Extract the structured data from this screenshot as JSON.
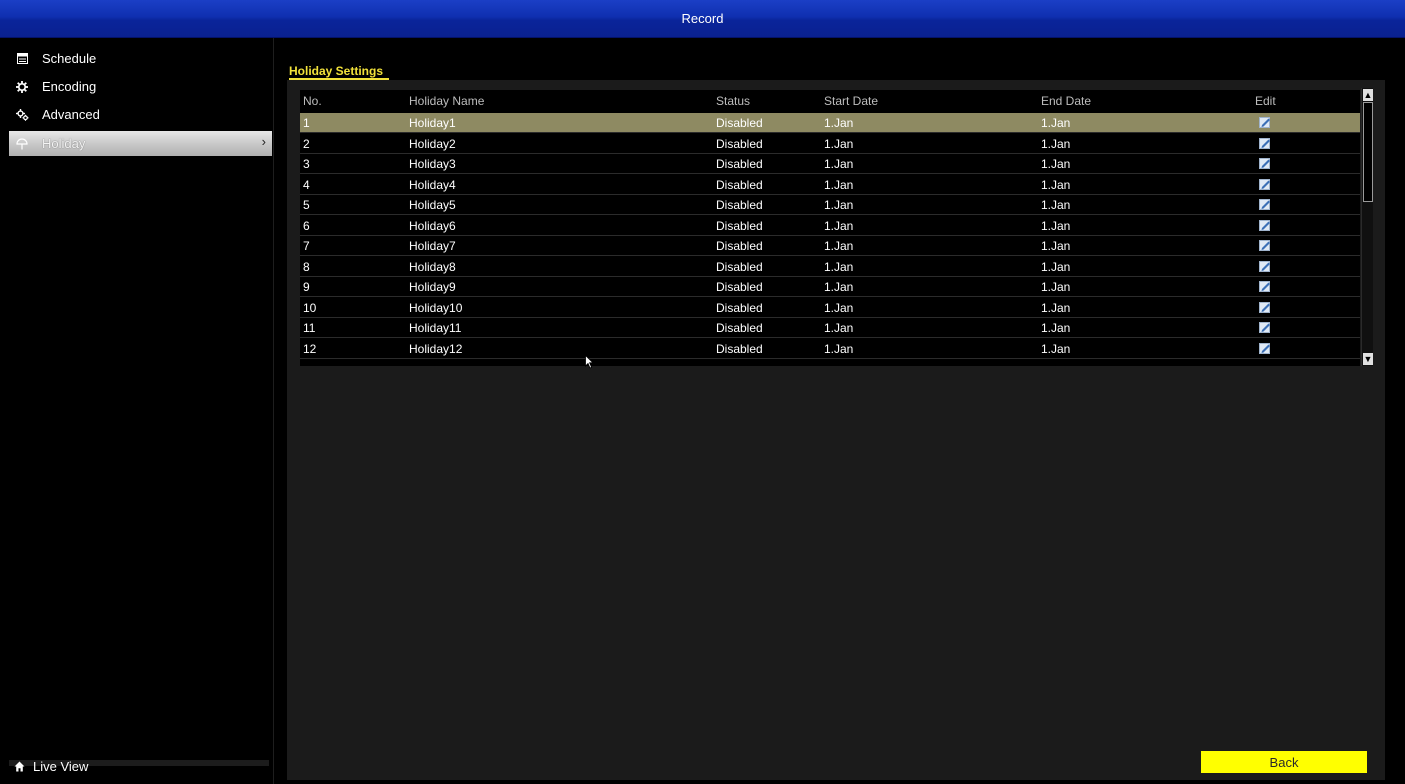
{
  "window": {
    "title": "Record"
  },
  "sidebar": {
    "items": [
      {
        "label": "Schedule",
        "icon": "schedule-icon"
      },
      {
        "label": "Encoding",
        "icon": "gear-icon"
      },
      {
        "label": "Advanced",
        "icon": "advanced-gear-icon"
      },
      {
        "label": "Holiday",
        "icon": "holiday-icon",
        "active": true
      }
    ],
    "live_view": {
      "label": "Live View",
      "icon": "home-icon"
    }
  },
  "main": {
    "section_title": "Holiday Settings",
    "table": {
      "headers": [
        "No.",
        "Holiday Name",
        "Status",
        "Start Date",
        "End Date",
        "Edit"
      ],
      "rows": [
        {
          "no": "1",
          "name": "Holiday1",
          "status": "Disabled",
          "start": "1.Jan",
          "end": "1.Jan",
          "selected": true
        },
        {
          "no": "2",
          "name": "Holiday2",
          "status": "Disabled",
          "start": "1.Jan",
          "end": "1.Jan"
        },
        {
          "no": "3",
          "name": "Holiday3",
          "status": "Disabled",
          "start": "1.Jan",
          "end": "1.Jan"
        },
        {
          "no": "4",
          "name": "Holiday4",
          "status": "Disabled",
          "start": "1.Jan",
          "end": "1.Jan"
        },
        {
          "no": "5",
          "name": "Holiday5",
          "status": "Disabled",
          "start": "1.Jan",
          "end": "1.Jan"
        },
        {
          "no": "6",
          "name": "Holiday6",
          "status": "Disabled",
          "start": "1.Jan",
          "end": "1.Jan"
        },
        {
          "no": "7",
          "name": "Holiday7",
          "status": "Disabled",
          "start": "1.Jan",
          "end": "1.Jan"
        },
        {
          "no": "8",
          "name": "Holiday8",
          "status": "Disabled",
          "start": "1.Jan",
          "end": "1.Jan"
        },
        {
          "no": "9",
          "name": "Holiday9",
          "status": "Disabled",
          "start": "1.Jan",
          "end": "1.Jan"
        },
        {
          "no": "10",
          "name": "Holiday10",
          "status": "Disabled",
          "start": "1.Jan",
          "end": "1.Jan"
        },
        {
          "no": "11",
          "name": "Holiday11",
          "status": "Disabled",
          "start": "1.Jan",
          "end": "1.Jan"
        },
        {
          "no": "12",
          "name": "Holiday12",
          "status": "Disabled",
          "start": "1.Jan",
          "end": "1.Jan"
        }
      ],
      "edit_icon": "edit-icon"
    },
    "back_label": "Back"
  },
  "colors": {
    "title_bar": "#0f2fb0",
    "accent_yellow": "#f2e23a",
    "selected_row": "#8e8a62",
    "back_button": "#ffff00",
    "panel_bg": "#1b1b1b"
  }
}
